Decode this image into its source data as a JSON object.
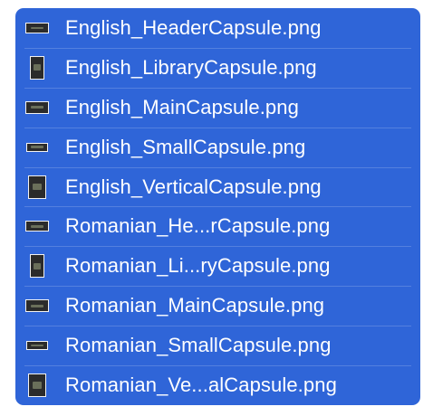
{
  "files": [
    {
      "name": "English_HeaderCapsule.png",
      "kind": "header"
    },
    {
      "name": "English_LibraryCapsule.png",
      "kind": "library"
    },
    {
      "name": "English_MainCapsule.png",
      "kind": "main"
    },
    {
      "name": "English_SmallCapsule.png",
      "kind": "small"
    },
    {
      "name": "English_VerticalCapsule.png",
      "kind": "vertical"
    },
    {
      "name": "Romanian_He...rCapsule.png",
      "kind": "header"
    },
    {
      "name": "Romanian_Li...ryCapsule.png",
      "kind": "library"
    },
    {
      "name": "Romanian_MainCapsule.png",
      "kind": "main"
    },
    {
      "name": "Romanian_SmallCapsule.png",
      "kind": "small"
    },
    {
      "name": "Romanian_Ve...alCapsule.png",
      "kind": "vertical"
    }
  ],
  "colors": {
    "selection": "#2f65d8",
    "text": "#ffffff"
  }
}
